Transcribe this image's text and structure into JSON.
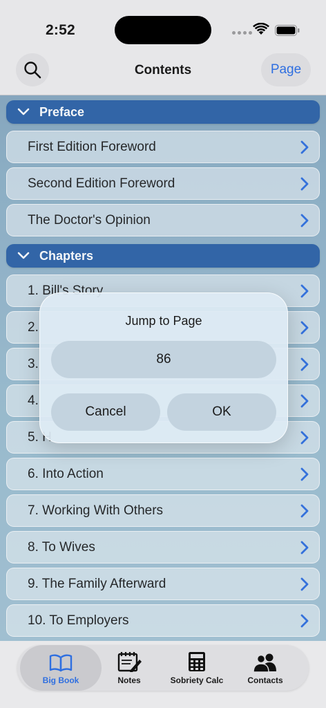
{
  "status_bar": {
    "time": "2:52"
  },
  "nav": {
    "title": "Contents",
    "page_button": "Page"
  },
  "sections": [
    {
      "title": "Preface",
      "items": [
        "First Edition Foreword",
        "Second Edition Foreword",
        "The Doctor's Opinion"
      ]
    },
    {
      "title": "Chapters",
      "items": [
        "1. Bill's Story",
        "2.",
        "3.",
        "4.",
        "5. H",
        "6. Into Action",
        "7. Working With Others",
        "8. To Wives",
        "9. The Family Afterward",
        "10. To Employers"
      ]
    }
  ],
  "dialog": {
    "title": "Jump to Page",
    "value": "86",
    "cancel": "Cancel",
    "ok": "OK"
  },
  "tabs": [
    {
      "label": "Big Book",
      "icon": "book-icon",
      "active": true
    },
    {
      "label": "Notes",
      "icon": "notes-icon",
      "active": false
    },
    {
      "label": "Sobriety Calc",
      "icon": "calculator-icon",
      "active": false
    },
    {
      "label": "Contacts",
      "icon": "contacts-icon",
      "active": false
    }
  ],
  "colors": {
    "accent": "#2f6fe0",
    "section_header": "#2d62a8"
  }
}
